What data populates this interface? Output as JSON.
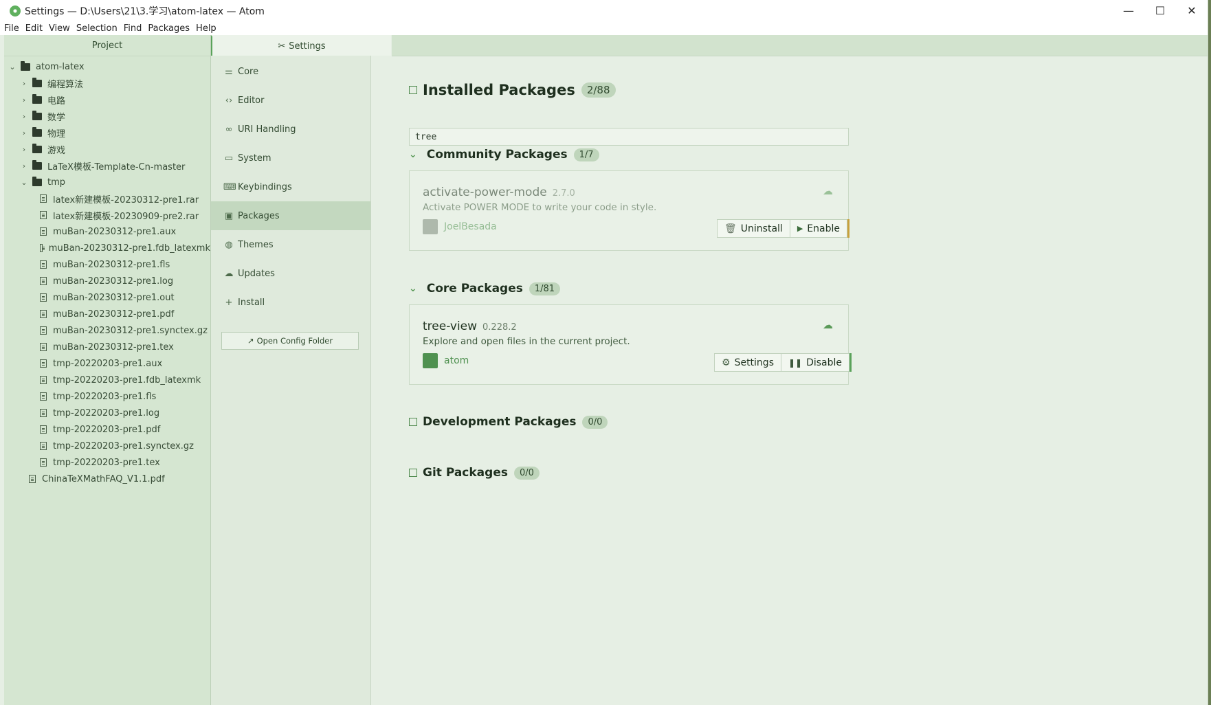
{
  "window": {
    "title": "Settings — D:\\Users\\21\\3.学习\\atom-latex — Atom",
    "controls": [
      "—",
      "☐",
      "✕"
    ]
  },
  "menu": [
    "File",
    "Edit",
    "View",
    "Selection",
    "Find",
    "Packages",
    "Help"
  ],
  "tree": {
    "header": "Project",
    "root": "atom-latex",
    "folders": [
      "编程算法",
      "电路",
      "数学",
      "物理",
      "游戏",
      "LaTeX模板-Template-Cn-master"
    ],
    "tmp_folder": "tmp",
    "tmp_files": [
      "latex新建模板-20230312-pre1.rar",
      "latex新建模板-20230909-pre2.rar",
      "muBan-20230312-pre1.aux",
      "muBan-20230312-pre1.fdb_latexmk",
      "muBan-20230312-pre1.fls",
      "muBan-20230312-pre1.log",
      "muBan-20230312-pre1.out",
      "muBan-20230312-pre1.pdf",
      "muBan-20230312-pre1.synctex.gz",
      "muBan-20230312-pre1.tex",
      "tmp-20220203-pre1.aux",
      "tmp-20220203-pre1.fdb_latexmk",
      "tmp-20220203-pre1.fls",
      "tmp-20220203-pre1.log",
      "tmp-20220203-pre1.pdf",
      "tmp-20220203-pre1.synctex.gz",
      "tmp-20220203-pre1.tex"
    ],
    "root_file": "ChinaTeXMathFAQ_V1.1.pdf"
  },
  "settings_tab": "Settings",
  "nav": {
    "items": [
      "Core",
      "Editor",
      "URI Handling",
      "System",
      "Keybindings",
      "Packages",
      "Themes",
      "Updates",
      "Install"
    ],
    "active": "Packages",
    "open_config": "Open Config Folder"
  },
  "packages": {
    "installed_title": "Installed Packages",
    "installed_count": "2/88",
    "filter_value": "tree",
    "community": {
      "title": "Community Packages",
      "count": "1/7",
      "pkg": {
        "name": "activate-power-mode",
        "version": "2.7.0",
        "description": "Activate POWER MODE to write your code in style.",
        "author": "JoelBesada",
        "buttons": [
          "Uninstall",
          "Enable"
        ]
      }
    },
    "core": {
      "title": "Core Packages",
      "count": "1/81",
      "pkg": {
        "name": "tree-view",
        "version": "0.228.2",
        "description": "Explore and open files in the current project.",
        "author": "atom",
        "buttons": [
          "Settings",
          "Disable"
        ]
      }
    },
    "development": {
      "title": "Development Packages",
      "count": "0/0"
    },
    "git": {
      "title": "Git Packages",
      "count": "0/0"
    }
  },
  "colors": {
    "accent": "#5aa25a",
    "enable_stripe": "#c9a13c",
    "disable_stripe": "#5aa25a"
  }
}
